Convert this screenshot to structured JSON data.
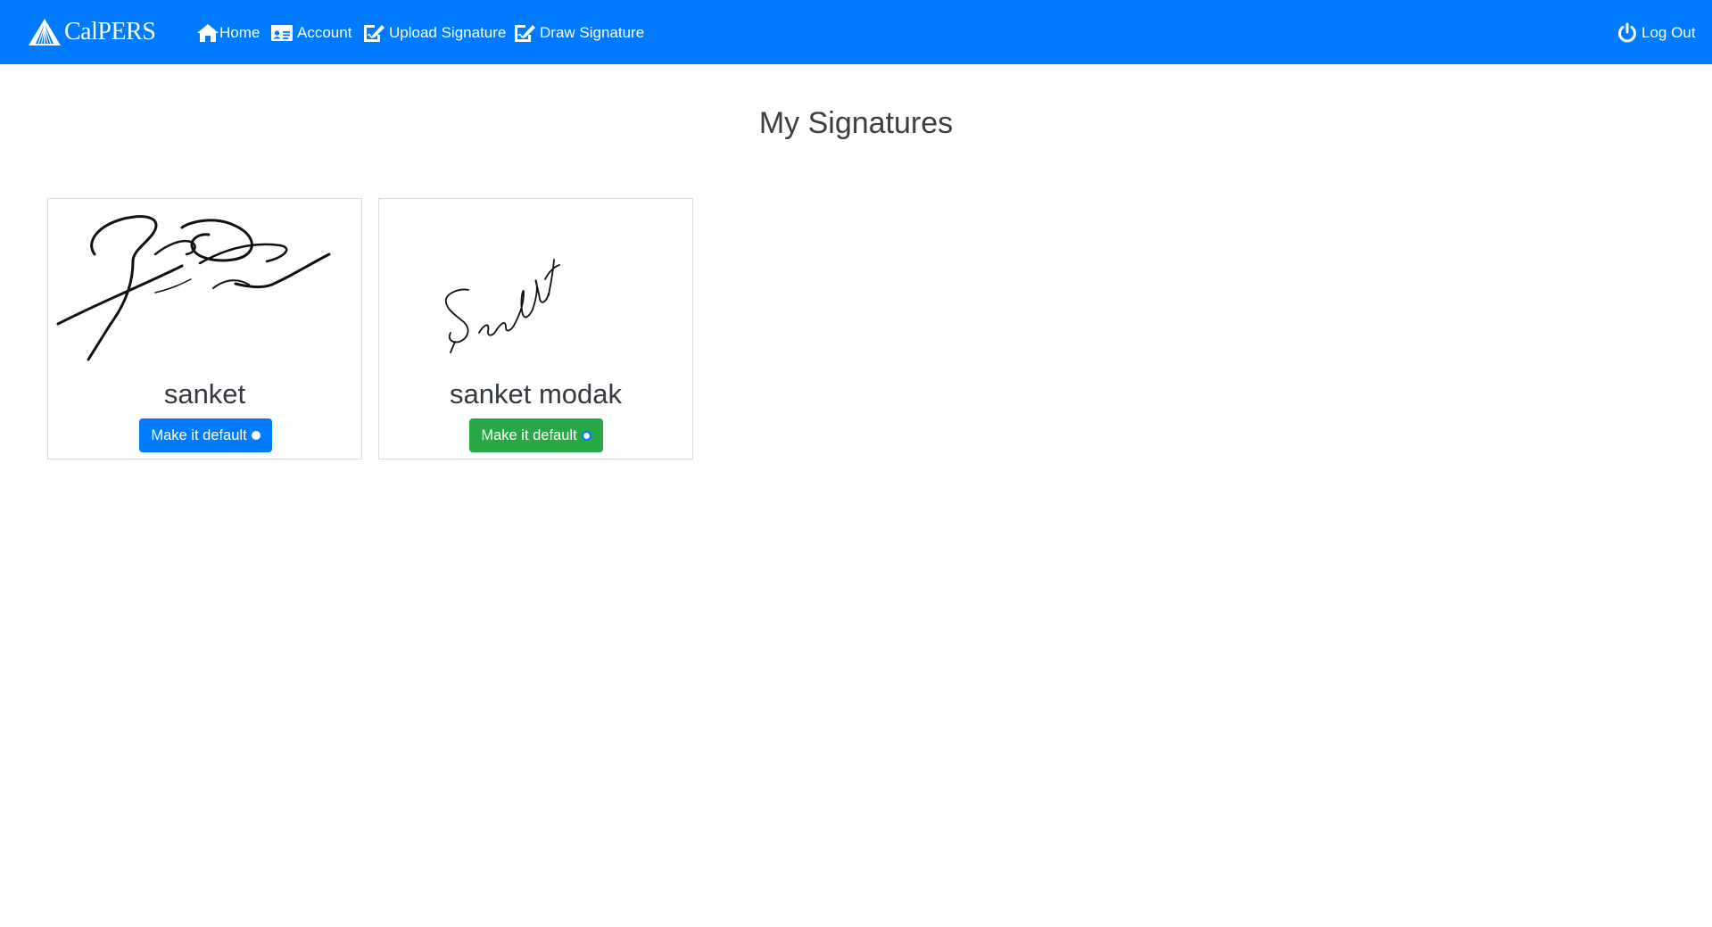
{
  "brand": {
    "name": "CalPERS"
  },
  "nav": {
    "home": "Home",
    "account": "Account",
    "upload": "Upload Signature",
    "draw": "Draw Signature",
    "logout": "Log Out"
  },
  "page": {
    "title": "My Signatures"
  },
  "signatures": [
    {
      "name": "sanket",
      "button_label": "Make it default",
      "button_color": "#007bff",
      "default_selected": true
    },
    {
      "name": "sanket modak",
      "button_label": "Make it default",
      "button_color": "#28a745",
      "default_selected": false
    }
  ],
  "colors": {
    "navbar": "#007bff",
    "primary": "#007bff",
    "success": "#28a745"
  }
}
